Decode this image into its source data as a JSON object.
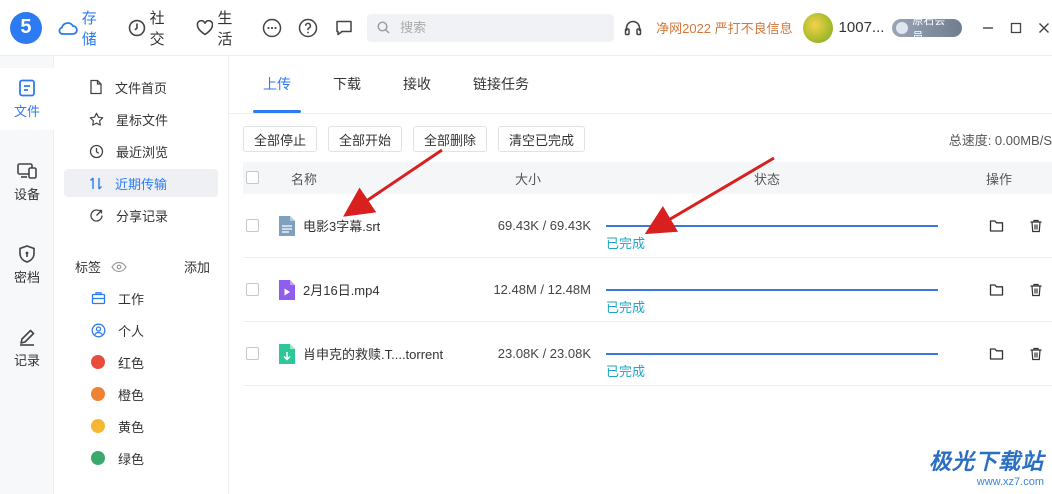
{
  "topbar": {
    "logo_text": "5",
    "nav": [
      {
        "label": "存储",
        "icon": "cloud-icon"
      },
      {
        "label": "社交",
        "icon": "clock-icon"
      },
      {
        "label": "生活",
        "icon": "heart-icon"
      }
    ],
    "search_placeholder": "搜索",
    "notice": "净网2022 严打不良信息",
    "username": "1007...",
    "member_badge": "原石会员"
  },
  "rail": [
    {
      "label": "文件",
      "icon": "file-icon",
      "active": true
    },
    {
      "label": "设备",
      "icon": "device-icon",
      "active": false
    },
    {
      "label": "密档",
      "icon": "shield-icon",
      "active": false
    },
    {
      "label": "记录",
      "icon": "pen-icon",
      "active": false
    }
  ],
  "side": {
    "items": [
      {
        "label": "文件首页",
        "icon": "document-icon"
      },
      {
        "label": "星标文件",
        "icon": "star-icon"
      },
      {
        "label": "最近浏览",
        "icon": "history-icon"
      },
      {
        "label": "近期传输",
        "icon": "transfer-icon",
        "active": true
      },
      {
        "label": "分享记录",
        "icon": "share-icon"
      }
    ],
    "tags_label": "标签",
    "tags_add": "添加",
    "tags": [
      {
        "label": "工作",
        "kind": "briefcase-icon"
      },
      {
        "label": "个人",
        "kind": "person-icon"
      },
      {
        "label": "红色",
        "color": "#e94c3d"
      },
      {
        "label": "橙色",
        "color": "#ef8134"
      },
      {
        "label": "黄色",
        "color": "#f5b731"
      },
      {
        "label": "绿色",
        "color": "#3aa96b"
      }
    ]
  },
  "tabs": [
    {
      "label": "上传",
      "active": true
    },
    {
      "label": "下载"
    },
    {
      "label": "接收"
    },
    {
      "label": "链接任务"
    }
  ],
  "toolbar": {
    "buttons": [
      "全部停止",
      "全部开始",
      "全部删除",
      "清空已完成"
    ],
    "speed": "总速度: 0.00MB/S"
  },
  "table": {
    "headers": {
      "name": "名称",
      "size": "大小",
      "status": "状态",
      "action": "操作"
    },
    "rows": [
      {
        "name": "电影3字幕.srt",
        "size": "69.43K / 69.43K",
        "status": "已完成",
        "progress": 1.0,
        "file_type": "subtitle",
        "icon_color": "#7fa0bf"
      },
      {
        "name": "2月16日.mp4",
        "size": "12.48M / 12.48M",
        "status": "已完成",
        "progress": 1.0,
        "file_type": "video",
        "icon_color": "#8f5ef0"
      },
      {
        "name": "肖申克的救赎.T....torrent",
        "size": "23.08K / 23.08K",
        "status": "已完成",
        "progress": 1.0,
        "file_type": "torrent",
        "icon_color": "#2ec79a"
      }
    ]
  },
  "watermark": {
    "title": "极光下载站",
    "url": "www.xz7.com"
  }
}
